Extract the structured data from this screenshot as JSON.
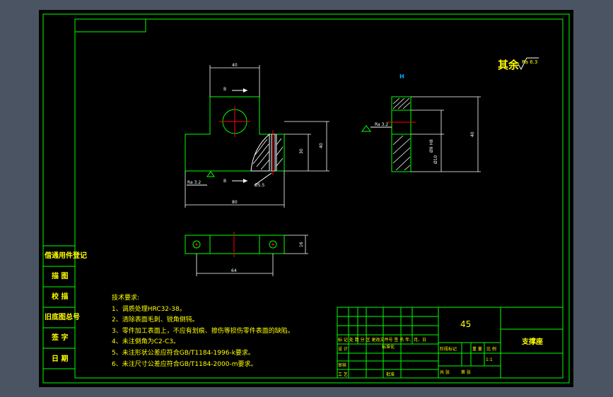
{
  "colors": {
    "background": "#4a5462",
    "canvas": "#000000",
    "line": "#00ff00",
    "text": "#ffff00",
    "centerline": "#ff0000",
    "hatch": "#ffffff",
    "dimension": "#ffffff"
  },
  "roughness": {
    "others_label": "其余",
    "others_value": "Ra 6.3",
    "surface_left": "Ra 3.2",
    "surface_side": "Ra 3.2"
  },
  "front_view": {
    "dim_top_width": "40",
    "dim_overall_width": "80",
    "dim_height_inner": "30",
    "dim_height_outer": "40",
    "section_top": "B",
    "section_bottom": "B",
    "hole_dia": "Ø5.5"
  },
  "side_view": {
    "section_label": "H",
    "dim_height": "40",
    "dim_hole_small": "Ø10",
    "dim_hole_large": "Ø9 H8"
  },
  "bottom_view": {
    "dim_hole_spacing": "64",
    "dim_height": "16"
  },
  "left_column": [
    "借通用件登记",
    "描 图",
    "校 描",
    "旧底图总号",
    "签 字",
    "日 期"
  ],
  "tech_requirements": {
    "title": "技术要求:",
    "items": [
      "1、调质处理HRC32-38。",
      "2、清除表面毛刺、锐角倒钝。",
      "3、零件加工表面上，不应有划痕、擦伤等损伤零件表面的缺陷。",
      "4、未注倒角为C2-C3。",
      "5、未注形状公差应符合GB/T1184-1996-k要求。",
      "6、未注尺寸公差应符合GB/T1184-2000-m要求。"
    ]
  },
  "title_block": {
    "material": "45",
    "part_name": "支撑座",
    "header_row": "标 记 处 数 分 区   更改文件号  签 名  年、月、日",
    "design_label": "设 计",
    "standard_label": "标准化",
    "stage_label": "阶段标记",
    "weight_label": "重 量",
    "scale_label": "比 例",
    "review_label": "审核",
    "process_label": "工 艺",
    "approve_label": "批准",
    "sheet_label": "共 张",
    "page_label": "第 张",
    "scale_value": "1:1"
  }
}
